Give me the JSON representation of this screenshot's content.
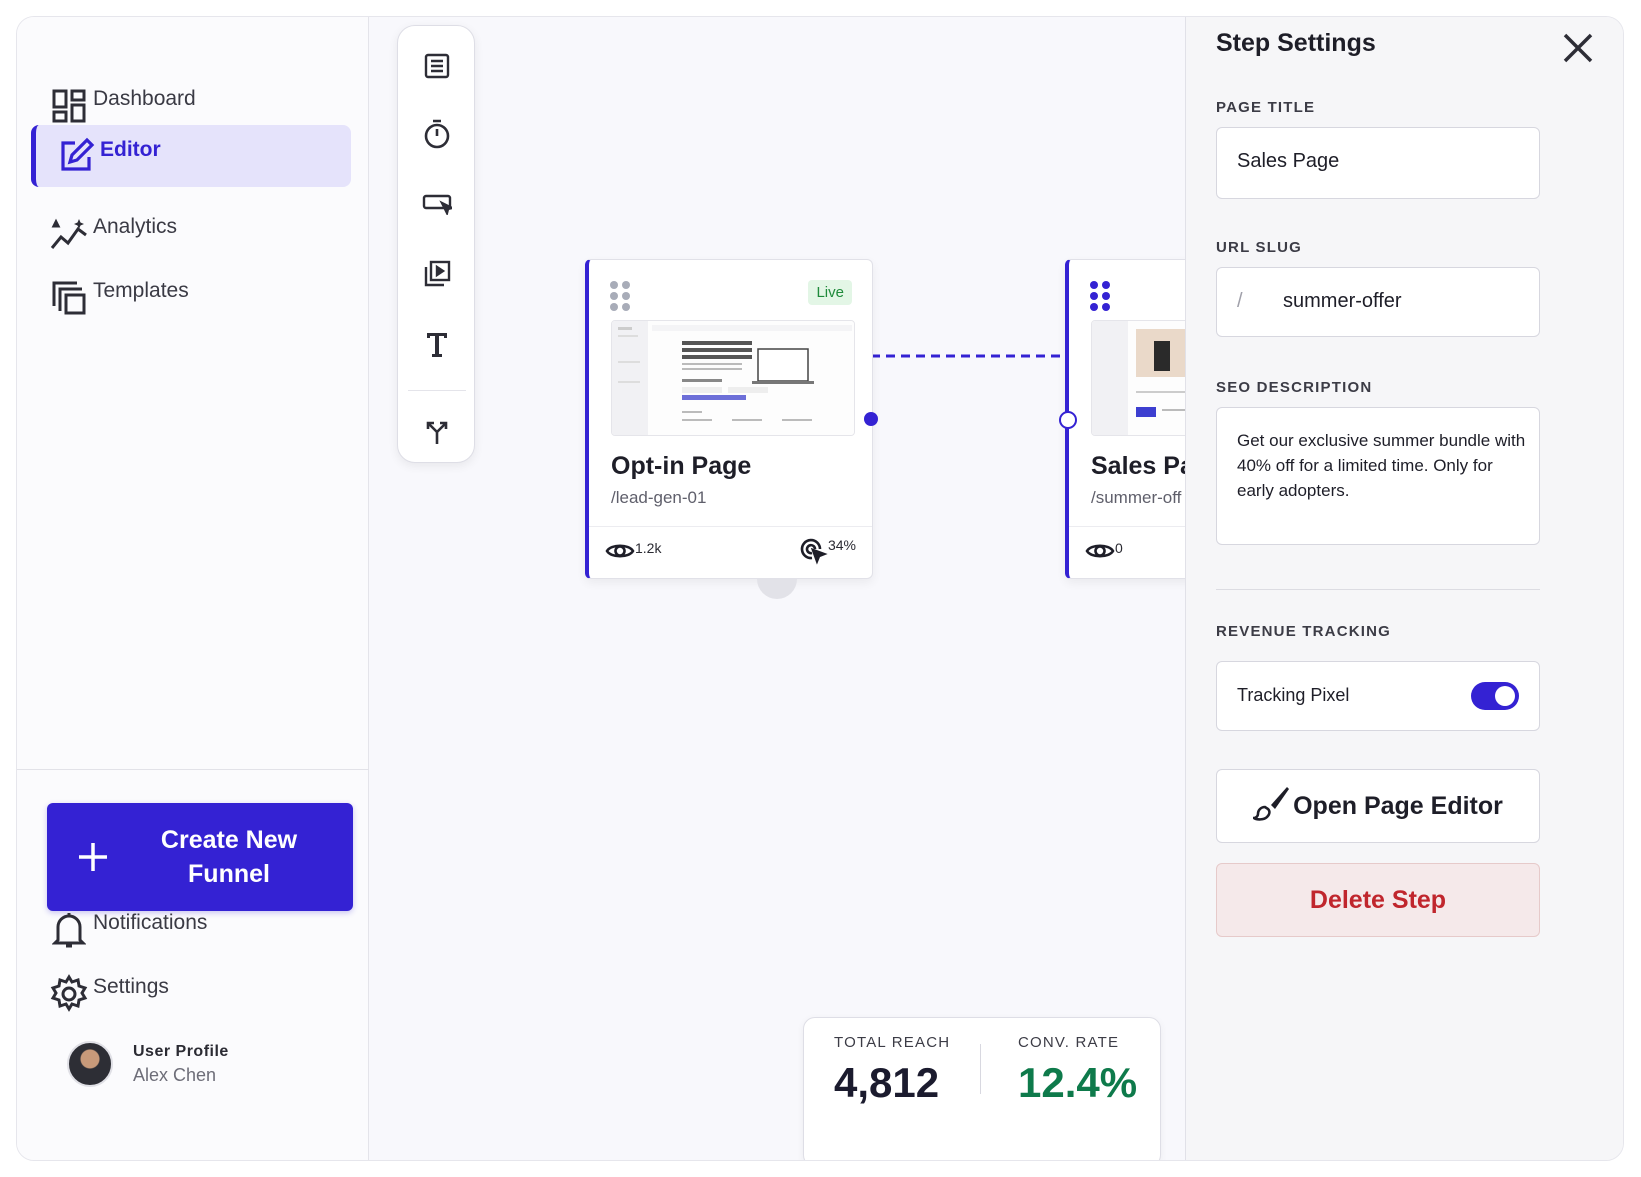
{
  "sidebar": {
    "items": [
      {
        "label": "Dashboard",
        "icon": "dashboard-icon",
        "active": false
      },
      {
        "label": "Editor",
        "icon": "edit-icon",
        "active": true
      },
      {
        "label": "Analytics",
        "icon": "analytics-icon",
        "active": false
      },
      {
        "label": "Templates",
        "icon": "templates-icon",
        "active": false
      }
    ],
    "create_button": {
      "line1": "Create New",
      "line2": "Funnel"
    },
    "bottom_items": [
      {
        "label": "Notifications",
        "icon": "bell-icon"
      },
      {
        "label": "Settings",
        "icon": "gear-icon"
      }
    ],
    "profile": {
      "title": "User Profile",
      "name": "Alex Chen"
    }
  },
  "toolbar": {
    "tools": [
      "form-icon",
      "timer-icon",
      "button-icon",
      "video-icon",
      "text-icon",
      "split-icon"
    ]
  },
  "canvas": {
    "cards": [
      {
        "title": "Opt-in Page",
        "slug": "/lead-gen-01",
        "badge": "Live",
        "views": "1.2k",
        "conversion": "34%"
      },
      {
        "title": "Sales Pa",
        "slug": "/summer-off",
        "views": "0"
      }
    ],
    "kpis": {
      "total_reach_label": "TOTAL REACH",
      "total_reach_value": "4,812",
      "conv_rate_label": "CONV. RATE",
      "conv_rate_value": "12.4%"
    }
  },
  "panel": {
    "title": "Step Settings",
    "page_title_label": "PAGE TITLE",
    "page_title_value": "Sales Page",
    "url_slug_label": "URL SLUG",
    "url_slug_prefix": "/",
    "url_slug_value": "summer-offer",
    "seo_label": "SEO DESCRIPTION",
    "seo_value": "Get our exclusive summer bundle with 40% off for a limited time. Only for early adopters.",
    "revenue_label": "REVENUE TRACKING",
    "tracking_label": "Tracking Pixel",
    "tracking_enabled": true,
    "open_editor": "Open Page Editor",
    "delete_step": "Delete Step"
  },
  "colors": {
    "accent": "#3422d3",
    "success": "#0e7a4b",
    "danger": "#c0262d",
    "badge_bg": "#e3f6e6"
  }
}
